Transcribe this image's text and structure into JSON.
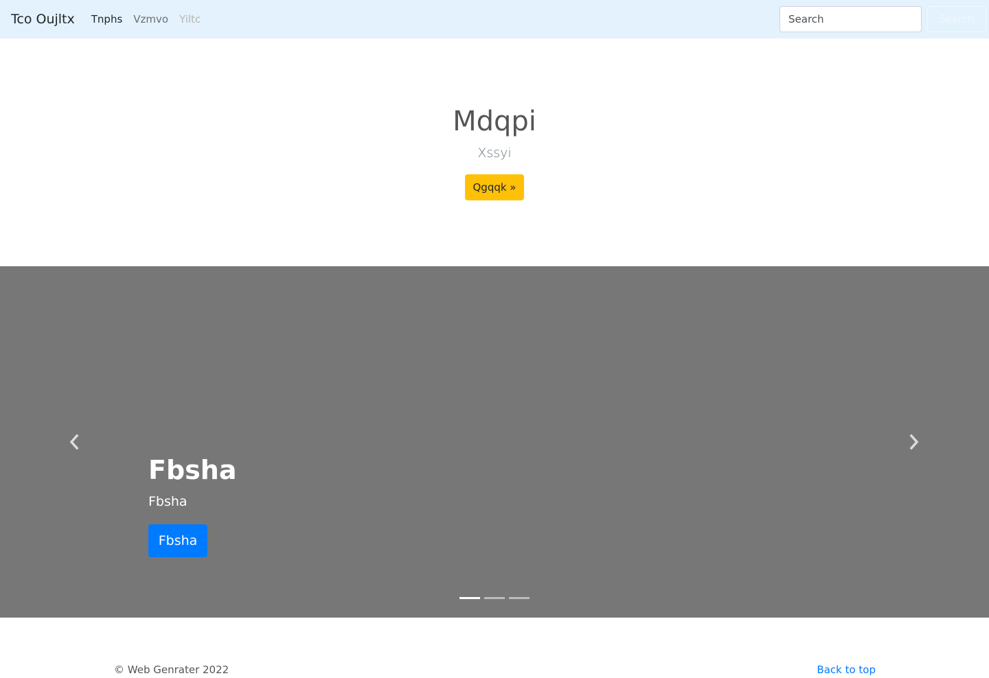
{
  "navbar": {
    "brand": "Tco Oujltx",
    "links": [
      {
        "label": "Tnphs",
        "state": "active"
      },
      {
        "label": "Vzmvo",
        "state": "normal"
      },
      {
        "label": "Yiltc",
        "state": "disabled"
      }
    ],
    "search": {
      "placeholder": "Search",
      "button_label": "Search"
    }
  },
  "hero": {
    "title": "Mdqpi",
    "subtitle": "Xssyi",
    "button_label": "Qgqqk »",
    "button_color": "#ffc107"
  },
  "carousel": {
    "background": "#777777",
    "prev_icon": "chevron-left-icon",
    "next_icon": "chevron-right-icon",
    "active_slide": 1,
    "slide_count": 3,
    "slide": {
      "title": "Fbsha",
      "text": "Fbsha",
      "button_label": "Fbsha",
      "button_color": "#007bff"
    }
  },
  "footer": {
    "copyright": "© Web Genrater 2022",
    "back_to_top": "Back to top",
    "link_color": "#007bff"
  }
}
